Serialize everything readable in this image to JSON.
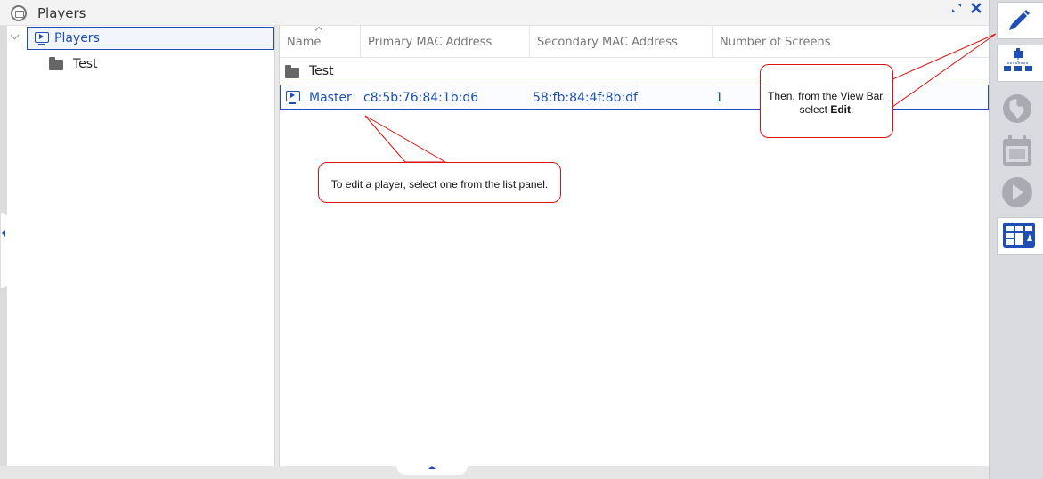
{
  "window": {
    "title": "Players",
    "icons": {
      "title": "player-window-icon",
      "restore": "restore-icon",
      "close": "close-icon"
    }
  },
  "tree": {
    "root": {
      "label": "Players",
      "icon": "player-icon",
      "expanded": true
    },
    "children": [
      {
        "label": "Test",
        "icon": "folder-icon"
      }
    ]
  },
  "list": {
    "columns": [
      {
        "label": "Name"
      },
      {
        "label": "Primary MAC Address"
      },
      {
        "label": "Secondary MAC Address"
      },
      {
        "label": "Number of Screens"
      }
    ],
    "rows": [
      {
        "type": "folder",
        "icon": "folder-icon",
        "name": "Test",
        "primary_mac": "",
        "secondary_mac": "",
        "screens": ""
      },
      {
        "type": "player",
        "icon": "player-icon",
        "name": "Master",
        "primary_mac": "c8:5b:76:84:1b:d6",
        "secondary_mac": "58:fb:84:4f:8b:df",
        "screens": "1"
      }
    ]
  },
  "viewbar": {
    "items": [
      {
        "name": "edit",
        "icon": "pencil-icon",
        "active": true
      },
      {
        "name": "hierarchy",
        "icon": "hierarchy-icon",
        "active": false
      },
      {
        "name": "globe",
        "icon": "globe-icon",
        "active": false
      },
      {
        "name": "calendar",
        "icon": "calendar-icon",
        "active": false
      },
      {
        "name": "play",
        "icon": "play-icon",
        "active": false
      },
      {
        "name": "layout",
        "icon": "layout-grid-icon",
        "active": false
      }
    ]
  },
  "callouts": {
    "select_player": "To edit a player, select one from the list panel.",
    "view_bar_line1": "Then, from the View Bar,",
    "view_bar_prefix": "select ",
    "view_bar_bold": "Edit",
    "view_bar_suffix": "."
  },
  "colors": {
    "accent": "#1f4fb5",
    "callout_border": "#dd1111",
    "viewbar_bg": "#d9dbe1"
  }
}
